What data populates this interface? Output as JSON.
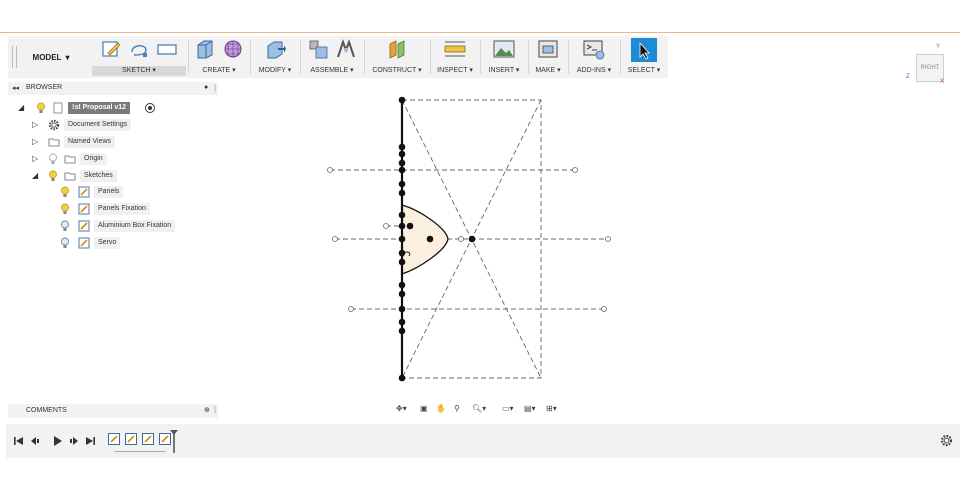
{
  "toolbar": {
    "mode": "MODEL",
    "groups": [
      {
        "label": "SKETCH ▾"
      },
      {
        "label": "CREATE ▾"
      },
      {
        "label": "MODIFY ▾"
      },
      {
        "label": "ASSEMBLE ▾"
      },
      {
        "label": "CONSTRUCT ▾"
      },
      {
        "label": "INSPECT ▾"
      },
      {
        "label": "INSERT ▾"
      },
      {
        "label": "MAKE ▾"
      },
      {
        "label": "ADD-INS ▾"
      },
      {
        "label": "SELECT ▾"
      }
    ]
  },
  "viewcube": {
    "face": "RIGHT",
    "axis_y": "Y",
    "axis_z": "Z",
    "axis_x": "X"
  },
  "browser": {
    "title": "BROWSER",
    "root": "!st Proposal v12",
    "items": [
      {
        "label": "Document Settings",
        "icon": "gear-icon"
      },
      {
        "label": "Named Views",
        "icon": "folder-icon"
      },
      {
        "label": "Origin",
        "icon": "folder-icon"
      },
      {
        "label": "Sketches",
        "icon": "folder-icon"
      }
    ],
    "sketches": [
      {
        "label": "Panels"
      },
      {
        "label": "Panels Fixation"
      },
      {
        "label": "Aluminium Box Fixation"
      },
      {
        "label": "Servo"
      }
    ]
  },
  "comments": {
    "title": "COMMENTS"
  },
  "colors": {
    "accent": "#1e8bd6",
    "sketch_fill": "#fbefe0",
    "toolbar_bg": "#f2f2f2"
  }
}
